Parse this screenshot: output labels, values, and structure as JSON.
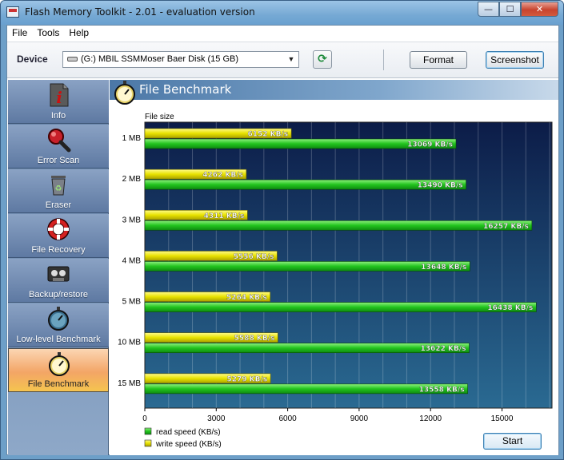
{
  "window": {
    "title": "Flash Memory Toolkit - 2.01 - evaluation version",
    "min_glyph": "—",
    "max_glyph": "☐",
    "close_glyph": "✕"
  },
  "menu": [
    "File",
    "Tools",
    "Help"
  ],
  "toolbar": {
    "device_label": "Device",
    "device_value": "(G:) MBIL SSMMoser Baer Disk (15 GB)",
    "format_label": "Format",
    "screenshot_label": "Screenshot"
  },
  "sidebar": {
    "items": [
      {
        "label": "Info",
        "icon": "info-icon"
      },
      {
        "label": "Error Scan",
        "icon": "magnifier-icon"
      },
      {
        "label": "Eraser",
        "icon": "recycle-bin-icon"
      },
      {
        "label": "File Recovery",
        "icon": "lifebuoy-icon"
      },
      {
        "label": "Backup/restore",
        "icon": "tape-icon"
      },
      {
        "label": "Low-level Benchmark",
        "icon": "stopwatch-icon"
      },
      {
        "label": "File Benchmark",
        "icon": "stopwatch-icon",
        "active": true
      }
    ]
  },
  "panel": {
    "title": "File Benchmark",
    "start_label": "Start"
  },
  "colors": {
    "read": "#22c41e",
    "write": "#e8e200",
    "plot_bg_top": "#0c1c48",
    "plot_bg_bottom": "#2a6a92"
  },
  "chart_data": {
    "type": "bar",
    "orientation": "horizontal",
    "ylabel": "File size",
    "categories": [
      "1 MB",
      "2 MB",
      "3 MB",
      "4 MB",
      "5 MB",
      "10 MB",
      "15 MB"
    ],
    "series": [
      {
        "name": "write speed (KB/s)",
        "values": [
          6152,
          4262,
          4311,
          5556,
          5264,
          5588,
          5279
        ]
      },
      {
        "name": "read speed (KB/s)",
        "values": [
          13069,
          13490,
          16257,
          13648,
          16438,
          13622,
          13558
        ]
      }
    ],
    "xlim": [
      0,
      17100
    ],
    "xticks": [
      0,
      3000,
      6000,
      9000,
      12000,
      15000
    ],
    "value_suffix": " KB/s",
    "legend": [
      "read speed (KB/s)",
      "write speed (KB/s)"
    ],
    "legend_position": "bottom-left",
    "grid": true
  }
}
